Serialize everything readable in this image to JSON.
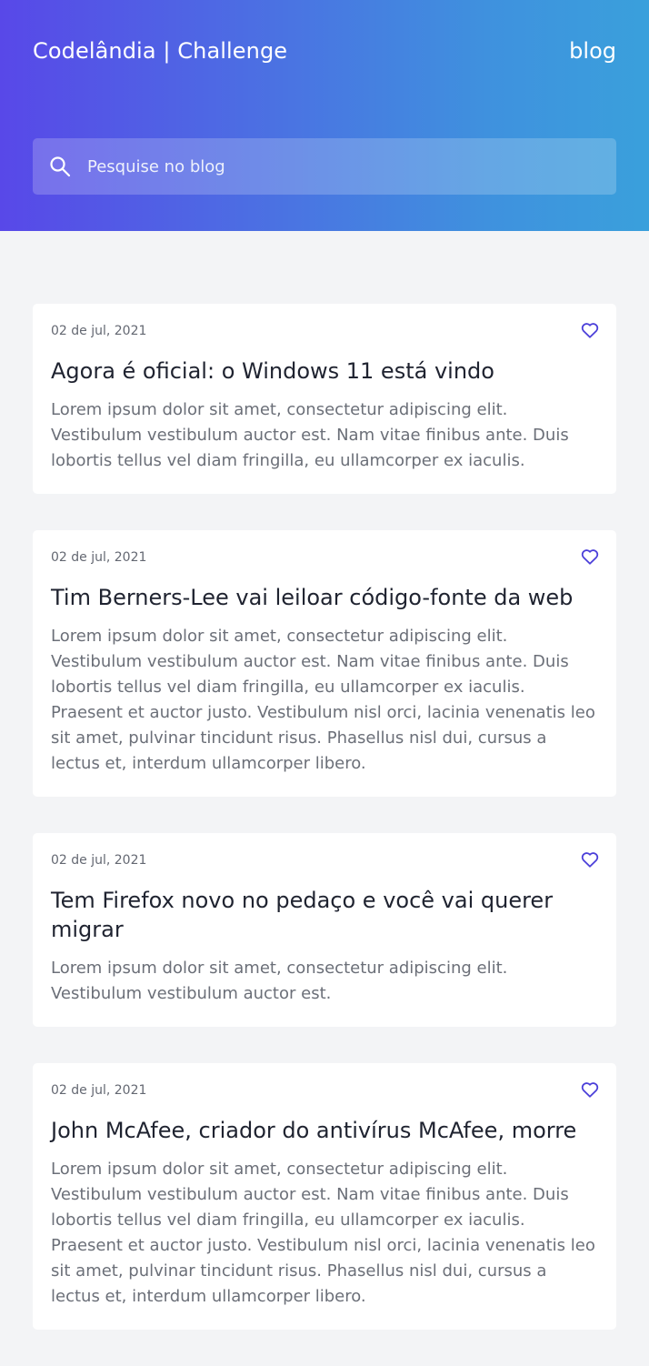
{
  "header": {
    "brand": "Codelândia | Challenge",
    "nav_link": "blog"
  },
  "search": {
    "placeholder": "Pesquise no blog",
    "value": "",
    "icon": "search-icon"
  },
  "colors": {
    "gradient_start": "#5848e8",
    "gradient_end": "#3aa0dc",
    "accent": "#4b3fd9",
    "background": "#f3f4f6"
  },
  "posts": [
    {
      "date": "02 de jul, 2021",
      "title": "Agora é oficial: o Windows 11 está vindo",
      "excerpt": "Lorem ipsum dolor sit amet, consectetur adipiscing elit. Vestibulum vestibulum auctor est. Nam vitae finibus ante. Duis lobortis tellus vel diam fringilla, eu ullamcorper ex iaculis.",
      "favorite_icon": "heart-icon"
    },
    {
      "date": "02 de jul, 2021",
      "title": "Tim Berners-Lee vai leiloar código-fonte da web",
      "excerpt": "Lorem ipsum dolor sit amet, consectetur adipiscing elit. Vestibulum vestibulum auctor est. Nam vitae finibus ante. Duis lobortis tellus vel diam fringilla, eu ullamcorper ex iaculis. Praesent et auctor justo. Vestibulum nisl orci, lacinia venenatis leo sit amet, pulvinar tincidunt risus. Phasellus nisl dui, cursus a lectus et, interdum ullamcorper libero.",
      "favorite_icon": "heart-icon"
    },
    {
      "date": "02 de jul, 2021",
      "title": "Tem Firefox novo no pedaço e você vai querer migrar",
      "excerpt": "Lorem ipsum dolor sit amet, consectetur adipiscing elit. Vestibulum vestibulum auctor est.",
      "favorite_icon": "heart-icon"
    },
    {
      "date": "02 de jul, 2021",
      "title": "John McAfee, criador do antivírus McAfee, morre",
      "excerpt": "Lorem ipsum dolor sit amet, consectetur adipiscing elit. Vestibulum vestibulum auctor est. Nam vitae finibus ante. Duis lobortis tellus vel diam fringilla, eu ullamcorper ex iaculis. Praesent et auctor justo. Vestibulum nisl orci, lacinia venenatis leo sit amet, pulvinar tincidunt risus. Phasellus nisl dui, cursus a lectus et, interdum ullamcorper libero.",
      "favorite_icon": "heart-icon"
    }
  ]
}
